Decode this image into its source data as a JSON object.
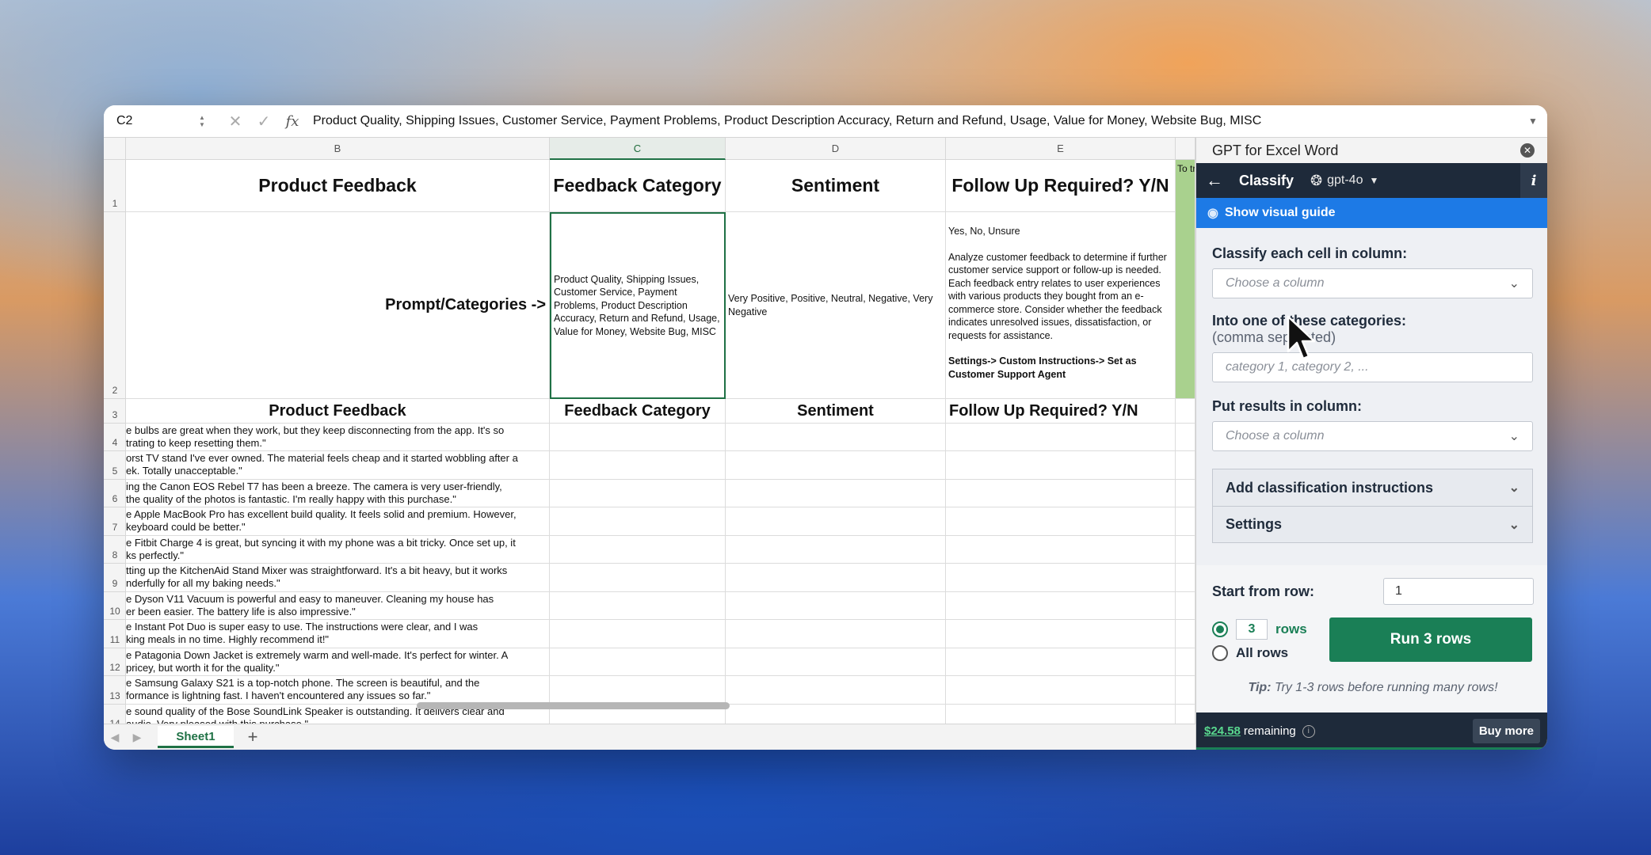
{
  "formula_bar": {
    "name_box": "C2",
    "formula": "Product Quality, Shipping Issues, Customer Service, Payment Problems, Product Description Accuracy, Return and Refund, Usage, Value for Money, Website Bug, MISC"
  },
  "columns": [
    "B",
    "C",
    "D",
    "E"
  ],
  "row_numbers": [
    "1",
    "2",
    "3",
    "4",
    "5",
    "6",
    "7",
    "8",
    "9",
    "10",
    "11",
    "12",
    "13",
    "14"
  ],
  "row1": {
    "b": "Product Feedback",
    "c": "Feedback Category",
    "d": "Sentiment",
    "e": "Follow Up Required? Y/N",
    "f": "To try thi"
  },
  "row2": {
    "b": "Prompt/Categories ->",
    "c": "Product Quality, Shipping Issues, Customer Service, Payment Problems, Product Description Accuracy, Return and Refund, Usage, Value for Money, Website Bug, MISC",
    "d": "Very Positive, Positive, Neutral, Negative, Very Negative",
    "e_line1": "Yes, No, Unsure",
    "e_line2": "Analyze customer feedback to determine if further customer service support or follow-up is needed. Each feedback entry relates to user experiences with various products they bought from an e-commerce store. Consider whether the feedback indicates unresolved issues, dissatisfaction, or requests for assistance.",
    "e_line3": "Settings-> Custom Instructions-> Set as Customer Support Agent"
  },
  "row3": {
    "b": "Product Feedback",
    "c": "Feedback Category",
    "d": "Sentiment",
    "e": "Follow Up Required? Y/N"
  },
  "feedback_rows": [
    {
      "l1": "e bulbs are great when they work, but they keep disconnecting from the app. It's so",
      "l2": "trating to keep resetting them.\""
    },
    {
      "l1": "orst TV stand I've ever owned. The material feels cheap and it started wobbling after a",
      "l2": "ek. Totally unacceptable.\""
    },
    {
      "l1": "ing the Canon EOS Rebel T7 has been a breeze. The camera is very user-friendly,",
      "l2": " the quality of the photos is fantastic. I'm really happy with this purchase.\""
    },
    {
      "l1": "e Apple MacBook Pro has excellent build quality. It feels solid and premium. However,",
      "l2": " keyboard could be better.\""
    },
    {
      "l1": "e Fitbit Charge 4 is great, but syncing it with my phone was a bit tricky. Once set up, it",
      "l2": "ks perfectly.\""
    },
    {
      "l1": "tting up the KitchenAid Stand Mixer was straightforward. It's a bit heavy, but it works",
      "l2": "nderfully for all my baking needs.\""
    },
    {
      "l1": "e Dyson V11 Vacuum is powerful and easy to maneuver. Cleaning my house has",
      "l2": "er been easier. The battery life is also impressive.\""
    },
    {
      "l1": "e Instant Pot Duo is super easy to use. The instructions were clear, and I was",
      "l2": "king meals in no time. Highly recommend it!\""
    },
    {
      "l1": "e Patagonia Down Jacket is extremely warm and well-made. It's perfect for winter. A",
      "l2": "pricey, but worth it for the quality.\""
    },
    {
      "l1": "e Samsung Galaxy S21 is a top-notch phone. The screen is beautiful, and the",
      "l2": "formance is lightning fast. I haven't encountered any issues so far.\""
    },
    {
      "l1": "e sound quality of the Bose SoundLink Speaker is outstanding. It delivers clear and",
      "l2": " audio. Very pleased with this purchase.\""
    }
  ],
  "sheet_tab": "Sheet1",
  "add_sheet": "+",
  "panel": {
    "title": "GPT for Excel Word",
    "nav_title": "Classify",
    "model": "gpt-4o",
    "info": "i",
    "visual_guide": "Show visual guide",
    "classify_label": "Classify each cell in column:",
    "classify_placeholder": "Choose a column",
    "categories_label": "Into one of these categories:",
    "categories_sub": "(comma separated)",
    "categories_placeholder": "category 1, category 2, ...",
    "results_label": "Put results in column:",
    "results_placeholder": "Choose a column",
    "accordion_instructions": "Add classification instructions",
    "accordion_settings": "Settings",
    "start_label": "Start from row:",
    "start_value": "1",
    "rows_count": "3",
    "rows_word": "rows",
    "all_rows": "All rows",
    "run_button": "Run 3 rows",
    "tip_bold": "Tip:",
    "tip_text": " Try 1-3 rows before running many rows!",
    "remaining_amount": "$24.58",
    "remaining_word": "remaining",
    "buy_more": "Buy more"
  },
  "colors": {
    "excel_green": "#1f7145",
    "run_green": "#1a7f56",
    "panel_dark": "#1e2a3a",
    "guide_blue": "#1d7ae6",
    "column_highlight": "#a9d18e"
  }
}
